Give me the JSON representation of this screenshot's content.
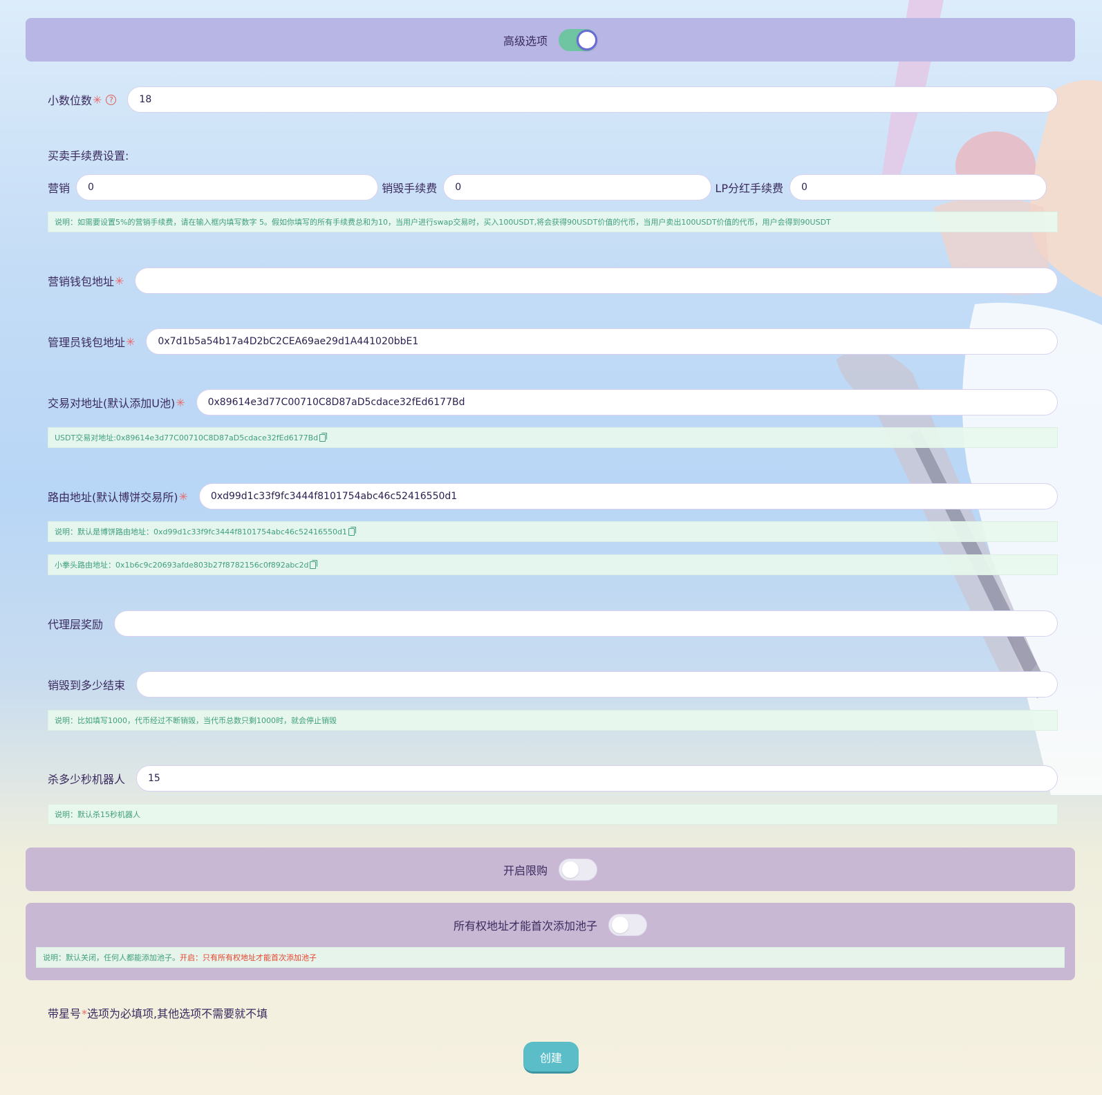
{
  "advanced": {
    "label": "高级选项",
    "enabled": true
  },
  "decimals": {
    "label": "小数位数",
    "value": "18"
  },
  "fees": {
    "section_title": "买卖手续费设置:",
    "marketing": {
      "label": "营销",
      "value": "0"
    },
    "burn": {
      "label": "销毁手续费",
      "value": "0"
    },
    "lp": {
      "label": "LP分红手续费",
      "value": "0"
    },
    "note": "说明：如需要设置5%的营销手续费，请在输入框内填写数字 5。假如你填写的所有手续费总和为10，当用户进行swap交易时，买入100USDT,将会获得90USDT价值的代币，当用户卖出100USDT价值的代币，用户会得到90USDT"
  },
  "marketing_wallet": {
    "label": "营销钱包地址",
    "value": ""
  },
  "admin_wallet": {
    "label": "管理员钱包地址",
    "value": "0x7d1b5a54b17a4D2bC2CEA69ae29d1A441020bbE1"
  },
  "pair": {
    "label": "交易对地址(默认添加U池)",
    "value": "0x89614e3d77C00710C8D87aD5cdace32fEd6177Bd",
    "note": "USDT交易对地址:0x89614e3d77C00710C8D87aD5cdace32fEd6177Bd"
  },
  "router": {
    "label": "路由地址(默认博饼交易所)",
    "value": "0xd99d1c33f9fc3444f8101754abc46c52416550d1",
    "note1": "说明：默认是博饼路由地址：0xd99d1c33f9fc3444f8101754abc46c52416550d1",
    "note2": "小拳头路由地址：0x1b6c9c20693afde803b27f8782156c0f892abc2d"
  },
  "agent_reward": {
    "label": "代理层奖励",
    "value": ""
  },
  "burn_until": {
    "label": "销毁到多少结束",
    "value": "",
    "note": "说明：比如填写1000，代币经过不断销毁，当代币总数只剩1000时，就会停止销毁"
  },
  "kill_bots": {
    "label": "杀多少秒机器人",
    "value": "15",
    "note": "说明：默认杀15秒机器人"
  },
  "limit_buy": {
    "label": "开启限购",
    "enabled": false
  },
  "owner_pool": {
    "label": "所有权地址才能首次添加池子",
    "enabled": false,
    "note_prefix": "说明：默认关闭，任何人都能添加池子。",
    "note_red": "开启：只有所有权地址才能首次添加池子"
  },
  "hint": {
    "prefix": "带星号",
    "star": "*",
    "suffix": "选项为必填项,其他选项不需要就不填"
  },
  "create_button": "创建",
  "colors": {
    "accent": "#5bbdc8",
    "required": "#e86a6a",
    "toggle_on": "#6fc4a2",
    "note_text": "#3f9f7a"
  }
}
